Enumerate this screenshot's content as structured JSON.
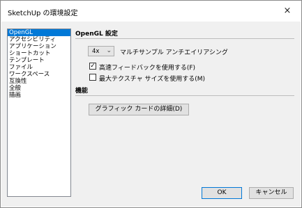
{
  "window": {
    "title": "SketchUp の環境設定",
    "close_symbol": "×"
  },
  "sidebar": {
    "items": [
      {
        "label": "OpenGL",
        "selected": true
      },
      {
        "label": "アクセシビリティ"
      },
      {
        "label": "アプリケーション"
      },
      {
        "label": "ショートカット"
      },
      {
        "label": "テンプレート"
      },
      {
        "label": "ファイル"
      },
      {
        "label": "ワークスペース"
      },
      {
        "label": "互換性"
      },
      {
        "label": "全般"
      },
      {
        "label": "描画"
      }
    ]
  },
  "opengl": {
    "section_title": "OpenGL 設定",
    "multisample_value": "4x",
    "multisample_label": "マルチサンプル アンチエイリアシング",
    "fast_feedback_label": "高速フィードバックを使用する(F)",
    "fast_feedback_checked": true,
    "max_texture_label": "最大テクスチャ サイズを使用する(M)",
    "max_texture_checked": false
  },
  "capabilities": {
    "section_title": "機能",
    "graphics_button_label": "グラフィック カードの詳細(D)"
  },
  "footer": {
    "ok_label": "OK",
    "cancel_label": "キャンセル"
  }
}
